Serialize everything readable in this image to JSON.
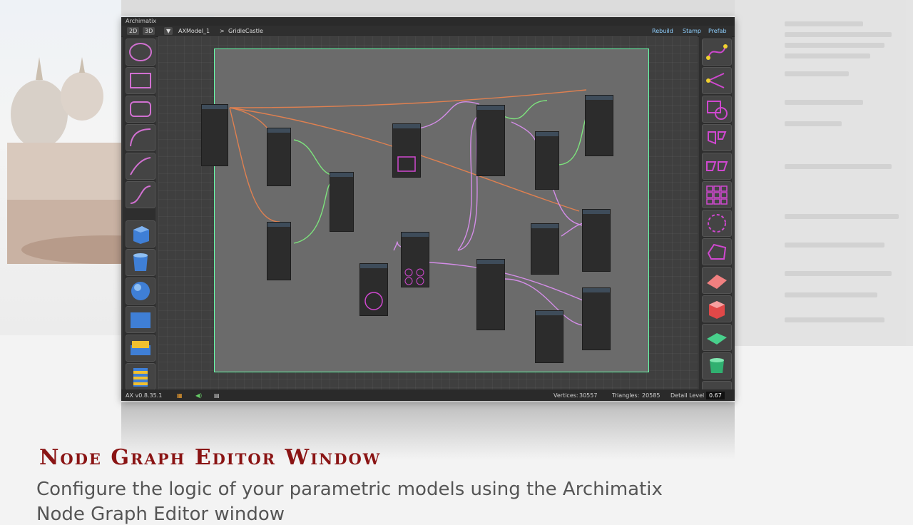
{
  "window": {
    "title": "Archimatix",
    "view_2d": "2D",
    "view_3d": "3D",
    "breadcrumb_model": "AXModel_1",
    "breadcrumb_separator": ">",
    "breadcrumb_node": "GridleCastle",
    "rebuild_label": "Rebuild",
    "stamp_label": "Stamp",
    "prefab_label": "Prefab"
  },
  "statusbar": {
    "version": "AX v0.8.35.1",
    "vertices_label": "Vertices:",
    "vertices_value": "30557",
    "triangles_label": "Triangles:",
    "triangles_value": "20585",
    "detail_label": "Detail Level",
    "detail_value": "0.67"
  },
  "caption": {
    "title": "Node Graph Editor Window",
    "subtitle": "Configure the logic of your parametric models using the Archimatix",
    "subtitle_line2": "Node Graph Editor window"
  },
  "left_tools": [
    "circle-icon",
    "rectangle-icon",
    "rounded-rect-icon",
    "arc-icon",
    "curve-icon",
    "s-curve-icon",
    "cube-icon",
    "cylinder-icon",
    "sphere-icon",
    "grid-icon",
    "bevel-icon",
    "stack-icon"
  ],
  "right_tools": [
    "spline-icon",
    "branch-icon",
    "shape-merge-icon",
    "shape-combine-icon",
    "offset-icon",
    "grid-repeat-icon",
    "radial-repeat-icon",
    "polygon-icon",
    "floor-icon",
    "box-icon",
    "plane-icon",
    "cylinder-icon",
    "lamp-icon"
  ],
  "colors": {
    "accent_red": "#8a1414",
    "wire_green": "#7de37d",
    "wire_pink": "#d48de8",
    "wire_orange": "#e08050"
  }
}
